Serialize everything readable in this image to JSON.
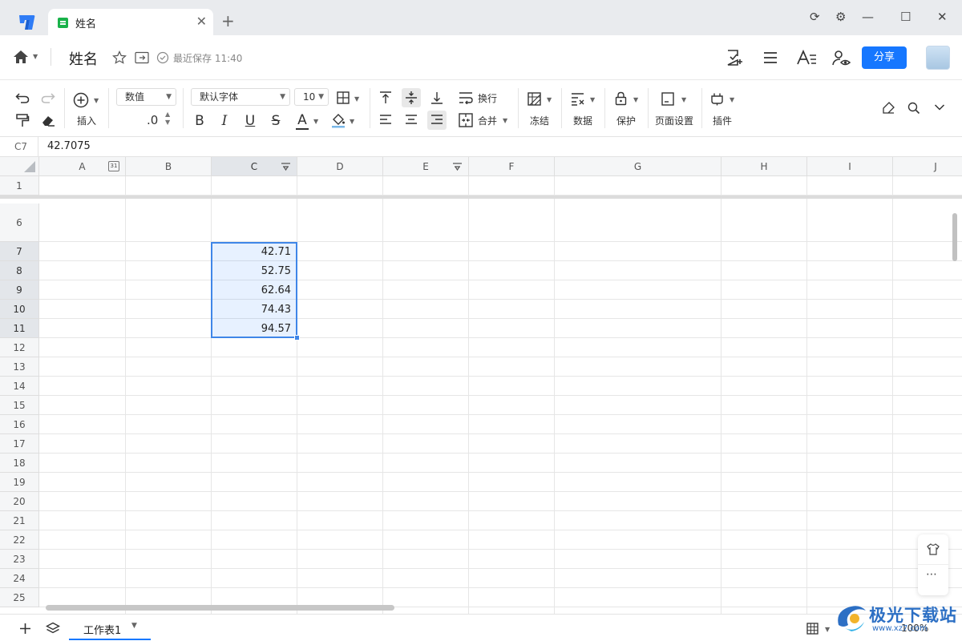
{
  "titlebar": {
    "tab_title": "姓名",
    "tab_close": "✕",
    "new_tab": "+",
    "window_controls": [
      "⟳",
      "⚙",
      "—",
      "☐",
      "✕"
    ]
  },
  "header": {
    "doc_title": "姓名",
    "save_status": "最近保存 11:40",
    "share_label": "分享",
    "icons": [
      "home-icon",
      "star-icon",
      "move-icon",
      "check-circle-icon",
      "doc-check-icon",
      "menu-icon",
      "text-format-icon",
      "user-eye-icon"
    ]
  },
  "toolbar": {
    "insert_label": "插入",
    "number_format": "数值",
    "decimal_label": ".0",
    "font_family": "默认字体",
    "font_size": "10",
    "wrap_label": "换行",
    "merge_label": "合并",
    "freeze_label": "冻结",
    "data_label": "数据",
    "protect_label": "保护",
    "page_setup_label": "页面设置",
    "plugin_label": "插件",
    "bold": "B",
    "italic": "I",
    "underline": "U",
    "strike": "S",
    "font_color": "A"
  },
  "formula_bar": {
    "cell_ref": "C7",
    "value": "42.7075"
  },
  "grid": {
    "columns": [
      "A",
      "B",
      "C",
      "D",
      "E",
      "F",
      "G",
      "H",
      "I",
      "J"
    ],
    "rows": [
      "1",
      "6",
      "7",
      "8",
      "9",
      "10",
      "11",
      "12",
      "13",
      "14",
      "15",
      "16",
      "17",
      "18",
      "19",
      "20",
      "21",
      "22",
      "23",
      "24",
      "25"
    ],
    "c_values": [
      "42.71",
      "52.75",
      "62.64",
      "74.43",
      "94.57"
    ],
    "calendar_badge": "31"
  },
  "bottom": {
    "sheet_name": "工作表1",
    "zoom": "100%"
  },
  "watermark": {
    "text": "极光下载站",
    "url": "www.xz7.com"
  },
  "colors": {
    "accent": "#1677ff",
    "selection_border": "#3f86e8",
    "sheet_icon": "#19b24a"
  }
}
